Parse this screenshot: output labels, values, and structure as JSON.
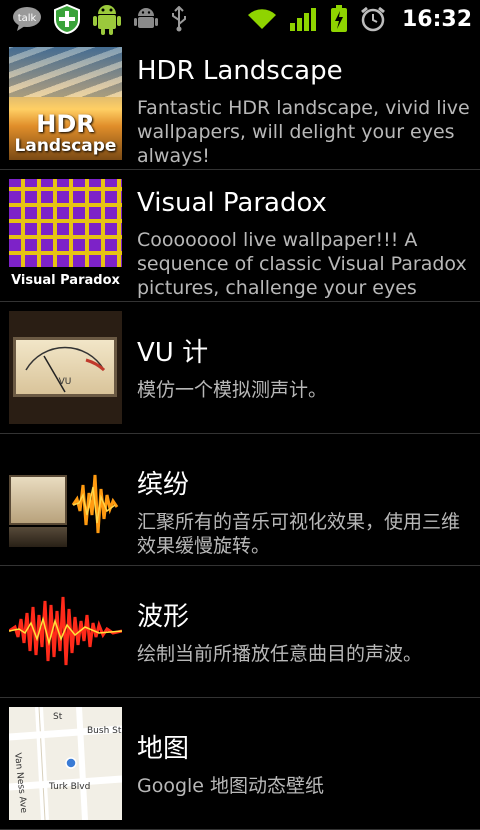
{
  "status_bar": {
    "time": "16:32",
    "left_icons": [
      "talk-icon",
      "market-add-icon",
      "android-icon",
      "android-debug-icon",
      "usb-icon"
    ],
    "right_icons": [
      "wifi-icon",
      "signal-icon",
      "battery-charging-icon",
      "alarm-icon"
    ],
    "talk_label": "talk"
  },
  "wallpapers": [
    {
      "title": "HDR Landscape",
      "description": "Fantastic HDR landscape, vivid live wallpapers, will delight your eyes always!",
      "thumb_line1": "HDR",
      "thumb_line2": "Landscape"
    },
    {
      "title": "Visual Paradox",
      "description": "Coooooool live wallpaper!!! A sequence of classic Visual Paradox pictures, challenge your eyes",
      "thumb_label": "Visual Paradox"
    },
    {
      "title": "VU 计",
      "description": "模仿一个模拟测声计。",
      "thumb_label": "VU"
    },
    {
      "title": "缤纷",
      "description": "汇聚所有的音乐可视化效果，使用三维效果缓慢旋转。"
    },
    {
      "title": "波形",
      "description": "绘制当前所播放任意曲目的声波。"
    },
    {
      "title": "地图",
      "description": "Google 地图动态壁纸",
      "map_labels": [
        "Van Ness Ave",
        "Bush St",
        "Turk Blvd",
        "St"
      ]
    }
  ],
  "colors": {
    "background": "#000000",
    "title": "#ffffff",
    "description": "#b8b8b8",
    "divider": "#333333",
    "status_green": "#8fd400"
  }
}
